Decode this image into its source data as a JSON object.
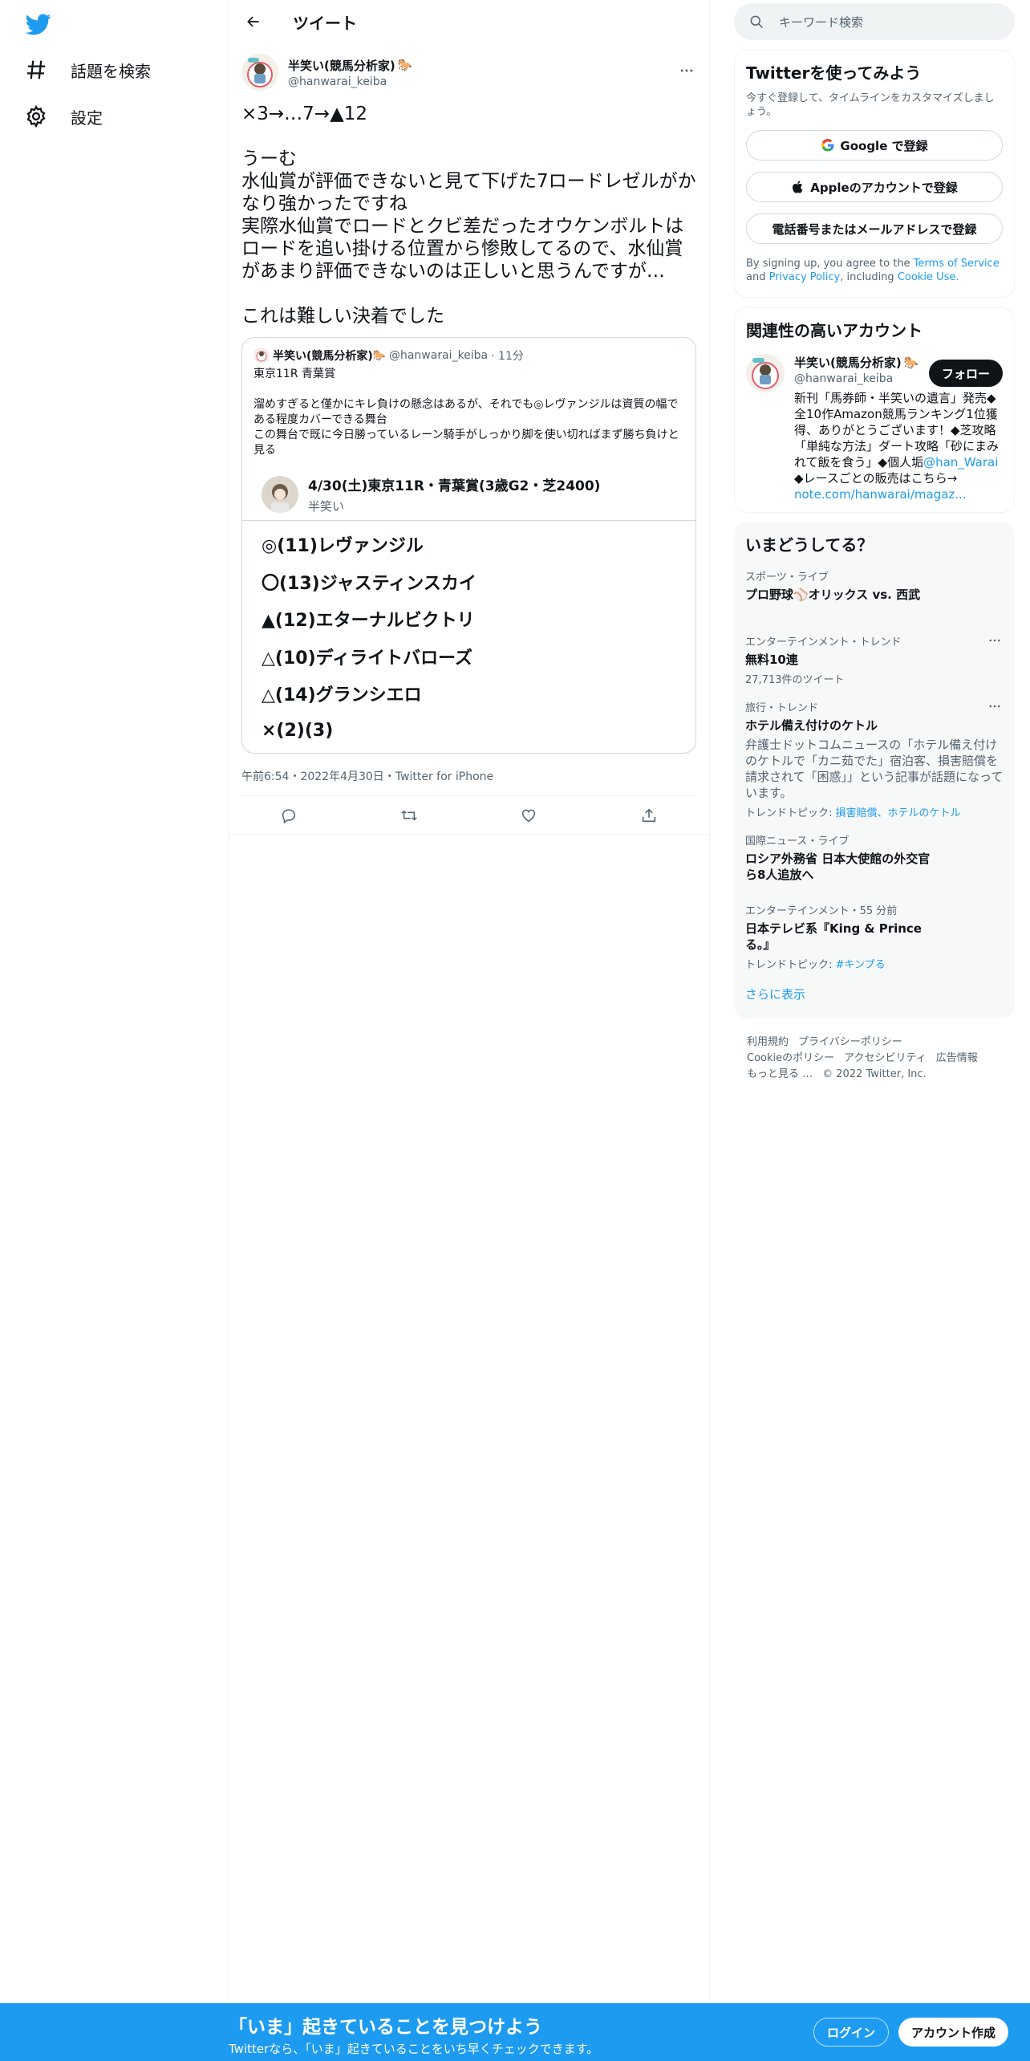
{
  "colors": {
    "brand": "#1d9bf0",
    "text": "#0f1419",
    "muted": "#536471",
    "border": "#eff3f4"
  },
  "leftnav": {
    "items": [
      {
        "label": "話題を検索",
        "icon": "hashtag-icon"
      },
      {
        "label": "設定",
        "icon": "gear-icon"
      }
    ]
  },
  "header": {
    "title": "ツイート"
  },
  "tweet": {
    "author_name": "半笑い(競馬分析家)",
    "author_handle": "@hanwarai_keiba",
    "text": "×3→…7→▲12\n\nうーむ\n水仙賞が評価できないと見て下げた7ロードレゼルがかなり強かったですね\n実際水仙賞でロードとクビ差だったオウケンボルトはロードを追い掛ける位置から惨敗してるので、水仙賞があまり評価できないのは正しいと思うんですが…\n\nこれは難しい決着でした",
    "meta": "午前6:54・2022年4月30日・Twitter for iPhone"
  },
  "quote": {
    "name": "半笑い(競馬分析家)",
    "handle": "@hanwarai_keiba",
    "time": "· 11分",
    "body": "東京11R 青葉賞\n\n溜めすぎると僅かにキレ負けの懸念はあるが、それでも◎レヴァンジルは資質の幅である程度カバーできる舞台\nこの舞台で既に今日勝っているレーン騎手がしっかり脚を使い切ればまず勝ち負けと見る",
    "card_title": "4/30(土)東京11R・青葉賞(3歳G2・芝2400)",
    "card_sub": "半笑い",
    "picks": [
      "◎(11)レヴァンジル",
      "〇(13)ジャスティンスカイ",
      "▲(12)エターナルビクトリ",
      "△(10)ディライトバローズ",
      "△(14)グランシエロ",
      "×(2)(3)"
    ]
  },
  "sidebar": {
    "search_placeholder": "キーワード検索",
    "signup": {
      "title": "Twitterを使ってみよう",
      "sub": "今すぐ登録して、タイムラインをカスタマイズしましょう。",
      "google": "Google で登録",
      "apple": "Appleのアカウントで登録",
      "phone": "電話番号またはメールアドレスで登録",
      "legal_prefix": "By signing up, you agree to the ",
      "tos": "Terms of Service",
      "legal_and": " and ",
      "privacy": "Privacy Policy",
      "legal_including": ", including ",
      "cookie": "Cookie Use."
    },
    "who": {
      "title": "関連性の高いアカウント",
      "name": "半笑い(競馬分析家)",
      "handle": "@hanwarai_keiba",
      "follow": "フォロー",
      "bio": "新刊「馬券師・半笑いの遺言」発売◆全10作Amazon競馬ランキング1位獲得、ありがとうございます！◆芝攻略「単純な方法」ダート攻略「砂にまみれて飯を食う」◆個人垢",
      "bio_link": "@han_Warai",
      "bio2": "◆レースごとの販売はこちら→",
      "bio_url": "note.com/hanwarai/magaz..."
    },
    "trends": {
      "title": "いまどうしてる？",
      "items": [
        {
          "cat": "スポーツ・ライブ",
          "title": "プロ野球⚾オリックス vs. 西武"
        },
        {
          "cat": "エンターテインメント・トレンド",
          "title": "無料10連",
          "count": "27,713件のツイート"
        },
        {
          "cat": "旅行・トレンド",
          "title": "ホテル備え付けのケトル",
          "desc": "弁護士ドットコムニュースの「ホテル備え付けのケトルで「カニ茹でた」宿泊客、損害賠償を請求されて「困惑」」という記事が話題になっています。",
          "topic_prefix": "トレンドトピック: ",
          "topic": "損害賠償、ホテルのケトル"
        },
        {
          "cat": "国際ニュース・ライブ",
          "title": "ロシア外務省 日本大使館の外交官ら8人追放へ"
        },
        {
          "cat": "エンターテインメント・55 分前",
          "title": "日本テレビ系『King & Prince る。』",
          "topic_prefix": "トレンドトピック: ",
          "topic": "#キンプる"
        }
      ],
      "show_more": "さらに表示"
    },
    "footer": {
      "links": [
        "利用規約",
        "プライバシーポリシー",
        "Cookieのポリシー",
        "アクセシビリティ",
        "広告情報",
        "もっと見る …",
        "© 2022 Twitter, Inc."
      ]
    }
  },
  "bottombar": {
    "title": "「いま」起きていることを見つけよう",
    "sub": "Twitterなら、「いま」起きていることをいち早くチェックできます。",
    "login": "ログイン",
    "signup": "アカウント作成"
  }
}
